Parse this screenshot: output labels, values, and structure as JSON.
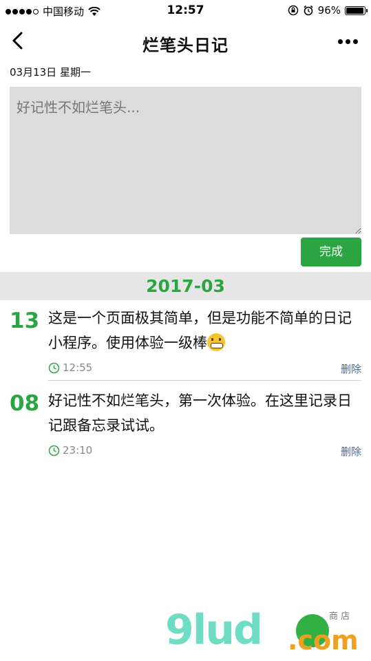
{
  "status_bar": {
    "carrier": "中国移动",
    "time": "12:57",
    "battery_text": "96%",
    "battery_level": 0.96
  },
  "nav": {
    "title": "烂笔头日记"
  },
  "editor": {
    "date": "03月13日 星期一",
    "placeholder": "好记性不如烂笔头...",
    "done_label": "完成"
  },
  "month_header": "2017-03",
  "entries": [
    {
      "day": "13",
      "text": "这是一个页面极其简单，但是功能不简单的日记小程序。使用体验一级棒",
      "time": "12:55",
      "delete_label": "删除"
    },
    {
      "day": "08",
      "text": "好记性不如烂笔头，第一次体验。在这里记录日记跟备忘录试试。",
      "time": "23:10",
      "delete_label": "删除"
    }
  ],
  "watermark": {
    "text": "9lud",
    "suffix": ".com",
    "small_text": "商 店"
  },
  "colors": {
    "accent": "#2aa542",
    "editor_bg": "#dcdcdc",
    "month_bar_bg": "#e6e6e6",
    "delete_link": "#4a6a9a"
  }
}
